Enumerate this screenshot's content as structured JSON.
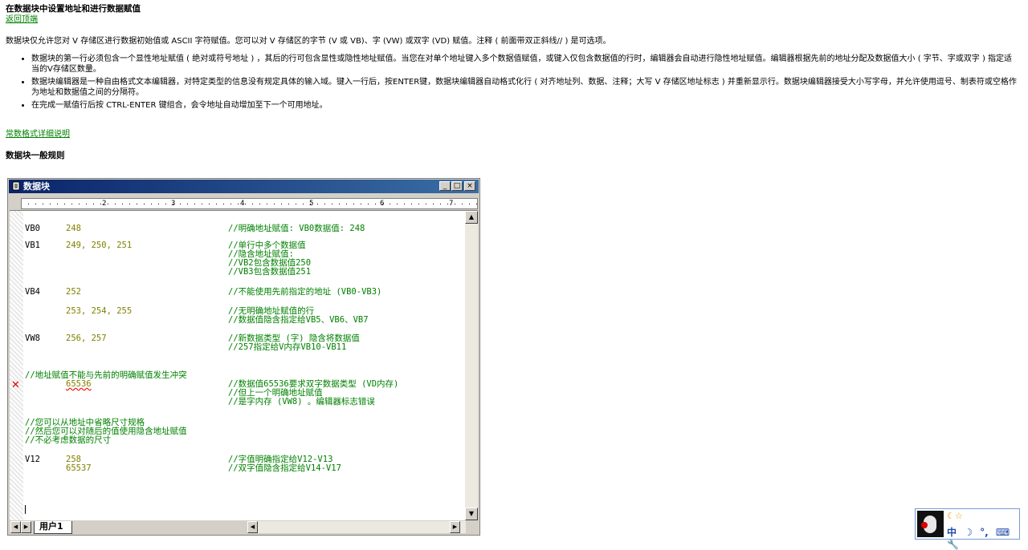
{
  "doc": {
    "title": "在数据块中设置地址和进行数据赋值",
    "back_link": "返回顶端",
    "intro": "数据块仅允许您对 V 存储区进行数据初始值或 ASCII 字符赋值。您可以对 V 存储区的字节 (V 或 VB)、字 (VW) 或双字 (VD) 赋值。注释 ( 前面带双正斜线// ) 是可选项。",
    "bullets": [
      "数据块的第一行必须包含一个显性地址赋值 ( 绝对或符号地址 ) ，其后的行可包含显性或隐性地址赋值。当您在对单个地址键入多个数据值赋值，或键入仅包含数据值的行时，编辑器会自动进行隐性地址赋值。编辑器根据先前的地址分配及数据值大小 ( 字节、字或双字 ) 指定适当的V存储区数量。",
      "数据块编辑器是一种自由格式文本编辑器，对特定类型的信息没有规定具体的输入域。键入一行后，按ENTER键，数据块编辑器自动格式化行 ( 对齐地址列、数据、注释；大写 V 存储区地址标志 ) 并重新显示行。数据块编辑器接受大小写字母，并允许使用逗号、制表符或空格作为地址和数据值之间的分隔符。",
      "在完成一赋值行后按 CTRL-ENTER 键组合，会令地址自动增加至下一个可用地址。"
    ],
    "format_link": "常数格式详细说明",
    "section_heading": "数据块一般规则"
  },
  "window": {
    "title": "数据块",
    "minimize": "_",
    "restore": "□",
    "close": "×",
    "ruler_numbers": [
      "2",
      "3",
      "4",
      "5",
      "6",
      "7"
    ],
    "tab_label": "用户1"
  },
  "editor_lines": {
    "l1": {
      "addr": "VB0",
      "val": "248",
      "cmt": "//明确地址赋值: VB0数据值: 248"
    },
    "l2": {
      "addr": "VB1",
      "val": "249, 250, 251",
      "cmt": "//单行中多个数据值"
    },
    "l3": {
      "cmt": "//隐含地址赋值:"
    },
    "l4": {
      "cmt": "//VB2包含数据值250"
    },
    "l5": {
      "cmt": "//VB3包含数据值251"
    },
    "l6": {
      "addr": "VB4",
      "val": "252",
      "cmt": "//不能使用先前指定的地址 (VB0-VB3)"
    },
    "l7": {
      "val": "253, 254, 255",
      "cmt": "//无明确地址赋值的行"
    },
    "l8": {
      "cmt": "//数据值隐含指定给VB5、VB6、VB7"
    },
    "l9": {
      "addr": "VW8",
      "val": "256, 257",
      "cmt": "//新数据类型 (字) 隐含将数据值"
    },
    "l10": {
      "cmt": "//257指定给V内存VB10-VB11"
    },
    "l11": {
      "full": "//地址赋值不能与先前的明确赋值发生冲突"
    },
    "l12": {
      "val": "65536",
      "cmt": "//数据值65536要求双字数据类型 (VD内存)"
    },
    "l13": {
      "cmt": "//但上一个明确地址赋值"
    },
    "l14": {
      "cmt": "//是字内存 (VW8) 。编辑器标志错误"
    },
    "l15": {
      "full": "//您可以从地址中省略尺寸规格"
    },
    "l16": {
      "full": "//然后您可以对随后的值使用隐含地址赋值"
    },
    "l17": {
      "full": "//不必考虑数据的尺寸"
    },
    "l18": {
      "addr": "V12",
      "val": "258",
      "cmt": "//字值明确指定给V12-V13"
    },
    "l19": {
      "val": "65537",
      "cmt": "//双字值隐含指定给V14-V17"
    }
  },
  "error_marker_icon": "red-x-icon",
  "tray": {
    "top": "☾☆",
    "items": [
      "中",
      "☽",
      "°,",
      "⌨",
      "🔧"
    ]
  }
}
